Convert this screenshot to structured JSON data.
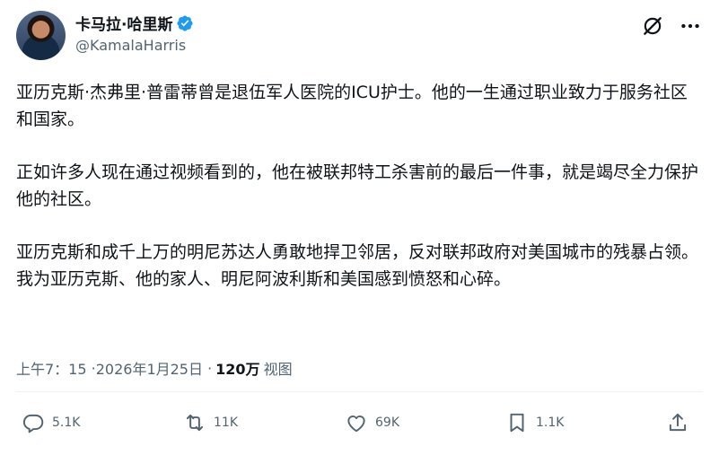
{
  "author": {
    "display_name": "卡马拉·哈里斯",
    "handle": "@KamalaHarris"
  },
  "post": {
    "paragraphs": [
      "亚历克斯·杰弗里·普雷蒂曾是退伍军人医院的ICU护士。他的一生通过职业致力于服务社区和国家。",
      "正如许多人现在通过视频看到的，他在被联邦特工杀害前的最后一件事，就是竭尽全力保护他的社区。",
      "亚历克斯和成千上万的明尼苏达人勇敢地捍卫邻居，反对联邦政府对美国城市的残暴占领。我为亚历克斯、他的家人、明尼阿波利斯和美国感到愤怒和心碎。"
    ],
    "time": "上午7：15",
    "date": "2026年1月25日",
    "views_count": "120万",
    "views_label": "视图"
  },
  "actions": {
    "replies": "5.1K",
    "reposts": "11K",
    "likes": "69K",
    "bookmarks": "1.1K"
  },
  "icons": [
    "verified-badge-icon",
    "grok-icon",
    "more-icon",
    "reply-icon",
    "repost-icon",
    "like-icon",
    "bookmark-icon",
    "share-icon"
  ],
  "colors": {
    "verified": "#1d9bf0",
    "text": "#0f1419",
    "secondary": "#536471"
  }
}
